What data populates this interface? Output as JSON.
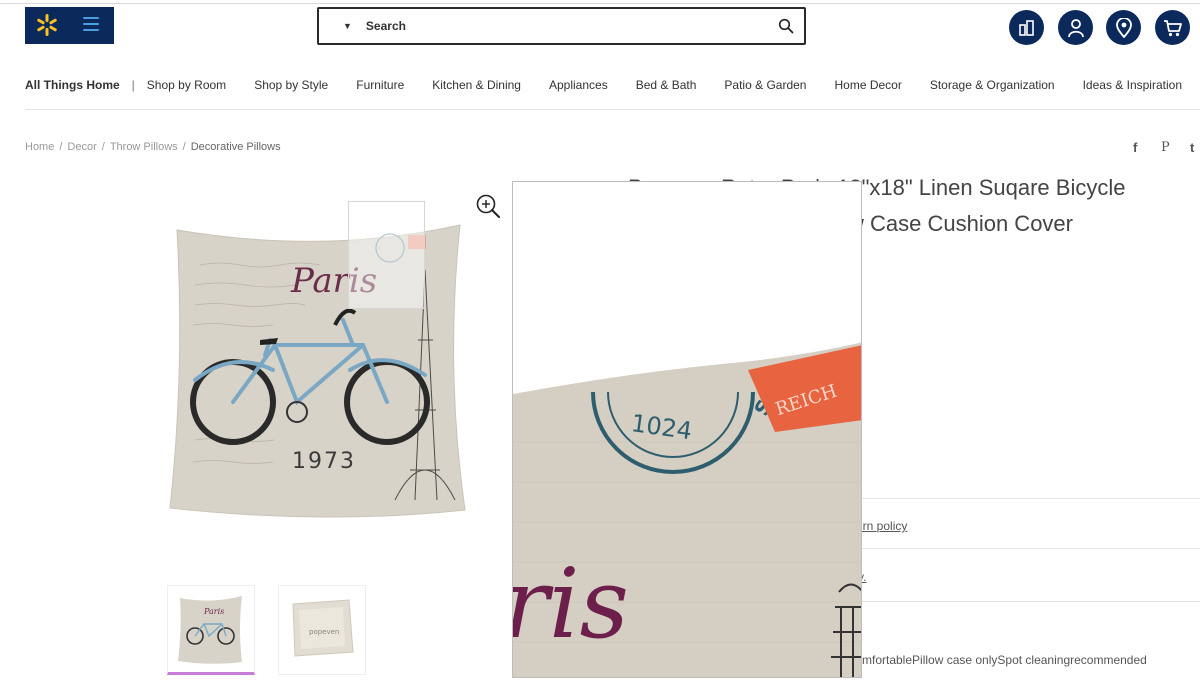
{
  "header": {
    "search_placeholder": "Search",
    "icons": [
      "walmart-spark-icon",
      "menu-icon",
      "search-icon",
      "reorder-icon",
      "account-icon",
      "location-icon",
      "cart-icon"
    ],
    "brand_color": "#0b2a5b",
    "spark_color": "#ffc220"
  },
  "nav": {
    "first": "All Things Home",
    "separator": "|",
    "items": [
      "Shop by Room",
      "Shop by Style",
      "Furniture",
      "Kitchen & Dining",
      "Appliances",
      "Bed & Bath",
      "Patio & Garden",
      "Home Decor",
      "Storage & Organization",
      "Ideas & Inspiration"
    ]
  },
  "breadcrumb": {
    "items": [
      "Home",
      "Decor",
      "Throw Pillows"
    ],
    "current": "Decorative Pillows",
    "separator": "/"
  },
  "share": {
    "icons": [
      "facebook-icon",
      "pinterest-icon",
      "twitter-icon"
    ],
    "labels": [
      "f",
      "P",
      "t"
    ]
  },
  "product": {
    "title_line1": "Popeven Retro Paris 18\"x18\" Linen Suqare Bicycle",
    "title_line2": "w Case Cushion Cover",
    "image_texts": {
      "script": "Paris",
      "year": "1973",
      "stamp_number": "1024",
      "stamp_word": "REICH",
      "stamp_letters": "ST",
      "zoom_script": "ris"
    },
    "thumb_brand": "popeven",
    "return_link": "urn policy",
    "dot_link": "y.",
    "description_tail": "mfortablePillow case onlySpot cleaningrecommended"
  }
}
